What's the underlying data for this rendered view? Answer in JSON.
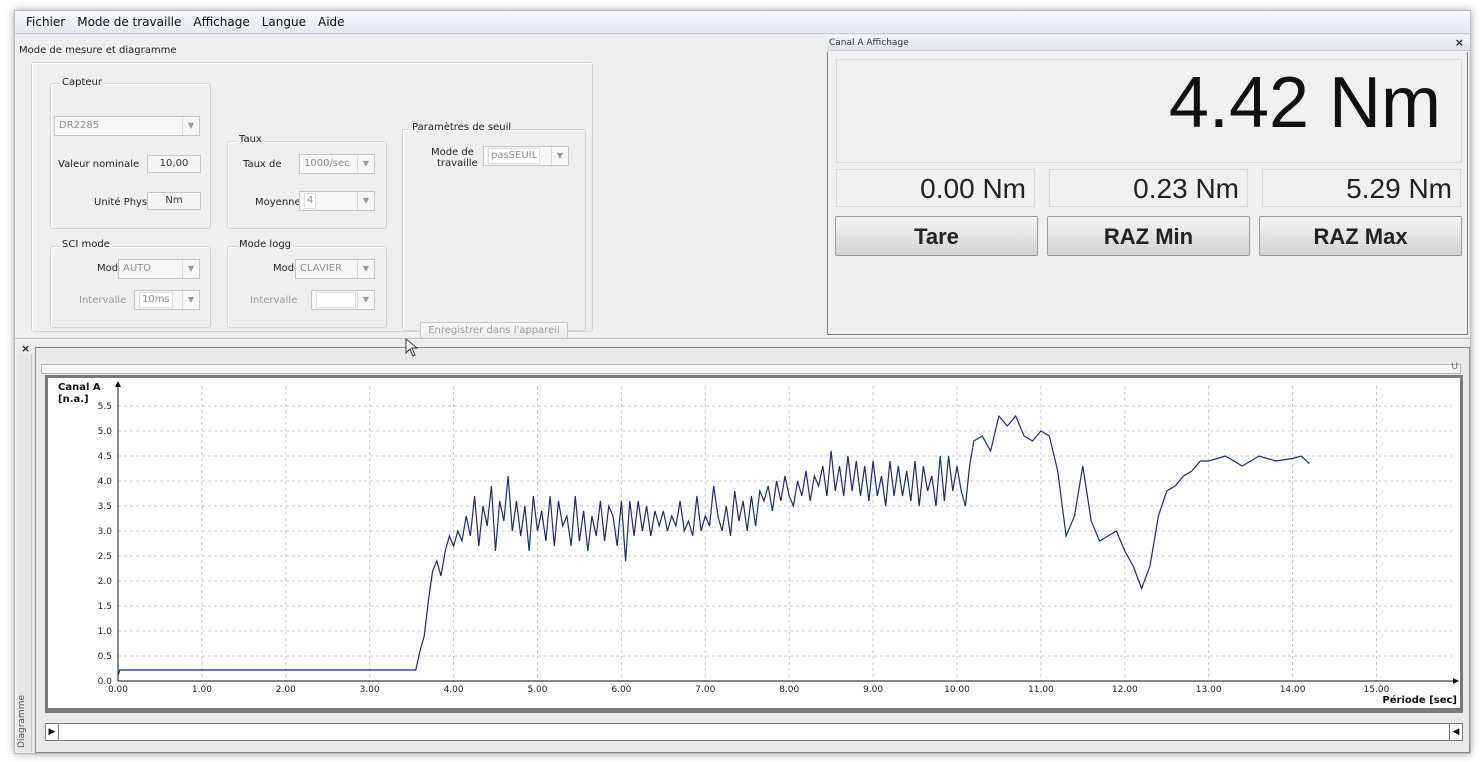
{
  "menu": [
    "Fichier",
    "Mode de travaille",
    "Affichage",
    "Langue",
    "Aide"
  ],
  "left_panel": {
    "title": "Mode de mesure et diagramme",
    "capteur": {
      "group": "Capteur",
      "sensor": "DR2285",
      "nominal_label": "Valeur nominale",
      "nominal_value": "10,00",
      "unit_label": "Unité Phys",
      "unit_value": "Nm"
    },
    "taux": {
      "group": "Taux",
      "rate_label": "Taux de",
      "rate_value": "1000/sec",
      "avg_label": "Moyenne",
      "avg_value": "4"
    },
    "seuil": {
      "group": "Paramètres de seuil",
      "mode_label_1": "Mode de",
      "mode_label_2": "travaille",
      "mode_value": "pasSEUIL"
    },
    "sci": {
      "group": "SCI mode",
      "mode_label": "Mode",
      "mode_value": "AUTO",
      "interval_label": "Intervalle",
      "interval_value": "10ms"
    },
    "logg": {
      "group": "Mode logg",
      "mode_label": "Mode",
      "mode_value": "CLAVIER",
      "interval_label": "Intervalle",
      "interval_value": ""
    },
    "save_button": "Enregistrer dans l'appareil"
  },
  "right_panel": {
    "title": "Canal A Affichage",
    "close": "×",
    "main_value": "4.42 Nm",
    "small_values": [
      "0.00 Nm",
      "0.23 Nm",
      "5.29 Nm"
    ],
    "buttons": [
      "Tare",
      "RAZ Min",
      "RAZ Max"
    ]
  },
  "diagram": {
    "close": "×",
    "side_label": "Diagramme",
    "top_slider_end": "U"
  },
  "chart_data": {
    "type": "line",
    "ylabel_1": "Canal A",
    "ylabel_2": "[n.a.]",
    "xlabel": "Période [sec]",
    "xlim": [
      0,
      15.9
    ],
    "ylim": [
      0,
      5.9
    ],
    "x_ticks": [
      "0.00",
      "1.00",
      "2.00",
      "3.00",
      "4.00",
      "5.00",
      "6.00",
      "7.00",
      "8.00",
      "9.00",
      "10.00",
      "11.00",
      "12.00",
      "13.00",
      "14.00",
      "15.00"
    ],
    "y_ticks": [
      "0.0",
      "0.5",
      "1.0",
      "1.5",
      "2.0",
      "2.5",
      "3.0",
      "3.5",
      "4.0",
      "4.5",
      "5.0",
      "5.5"
    ],
    "grid": true,
    "series_color": "#1f2a7a",
    "x": [
      0,
      0.02,
      3.55,
      3.6,
      3.65,
      3.7,
      3.75,
      3.8,
      3.85,
      3.9,
      3.95,
      4.0,
      4.05,
      4.1,
      4.15,
      4.2,
      4.25,
      4.3,
      4.35,
      4.4,
      4.45,
      4.5,
      4.55,
      4.6,
      4.65,
      4.7,
      4.75,
      4.8,
      4.85,
      4.9,
      4.95,
      5.0,
      5.05,
      5.1,
      5.15,
      5.2,
      5.25,
      5.3,
      5.35,
      5.4,
      5.45,
      5.5,
      5.55,
      5.6,
      5.65,
      5.7,
      5.75,
      5.8,
      5.85,
      5.9,
      5.95,
      6.0,
      6.05,
      6.1,
      6.15,
      6.2,
      6.25,
      6.3,
      6.35,
      6.4,
      6.45,
      6.5,
      6.55,
      6.6,
      6.65,
      6.7,
      6.75,
      6.8,
      6.85,
      6.9,
      6.95,
      7.0,
      7.05,
      7.1,
      7.15,
      7.2,
      7.25,
      7.3,
      7.35,
      7.4,
      7.45,
      7.5,
      7.55,
      7.6,
      7.65,
      7.7,
      7.75,
      7.8,
      7.85,
      7.9,
      7.95,
      8.0,
      8.05,
      8.1,
      8.15,
      8.2,
      8.25,
      8.3,
      8.35,
      8.4,
      8.45,
      8.5,
      8.55,
      8.6,
      8.65,
      8.7,
      8.75,
      8.8,
      8.85,
      8.9,
      8.95,
      9.0,
      9.05,
      9.1,
      9.15,
      9.2,
      9.25,
      9.3,
      9.35,
      9.4,
      9.45,
      9.5,
      9.55,
      9.6,
      9.65,
      9.7,
      9.75,
      9.8,
      9.85,
      9.9,
      9.95,
      10.0,
      10.05,
      10.1,
      10.15,
      10.2,
      10.3,
      10.4,
      10.5,
      10.6,
      10.7,
      10.8,
      10.9,
      11.0,
      11.1,
      11.2,
      11.3,
      11.4,
      11.5,
      11.6,
      11.7,
      11.8,
      11.9,
      12.0,
      12.1,
      12.2,
      12.3,
      12.4,
      12.5,
      12.6,
      12.7,
      12.8,
      12.9,
      13.0,
      13.2,
      13.4,
      13.6,
      13.8,
      14.0,
      14.1,
      14.2,
      14.3,
      14.4,
      14.5,
      14.6,
      14.7
    ],
    "y": [
      0.1,
      0.22,
      0.22,
      0.6,
      0.9,
      1.6,
      2.2,
      2.4,
      2.1,
      2.6,
      2.9,
      2.7,
      3.0,
      2.8,
      3.3,
      2.9,
      3.7,
      2.7,
      3.5,
      3.1,
      3.9,
      2.6,
      3.6,
      3.2,
      4.1,
      3.0,
      3.6,
      2.9,
      3.5,
      2.6,
      3.7,
      3.0,
      3.4,
      2.8,
      3.7,
      2.7,
      3.6,
      3.1,
      3.3,
      2.7,
      3.7,
      2.8,
      3.4,
      2.6,
      3.3,
      2.9,
      3.6,
      2.8,
      3.5,
      3.3,
      2.7,
      3.6,
      2.4,
      3.6,
      2.9,
      3.6,
      3.0,
      3.5,
      2.9,
      3.4,
      3.1,
      3.4,
      3.0,
      3.3,
      3.1,
      3.6,
      3.0,
      3.2,
      2.9,
      3.7,
      3.0,
      3.3,
      3.1,
      3.9,
      3.3,
      3.0,
      3.5,
      2.9,
      3.8,
      3.2,
      3.6,
      3.0,
      3.7,
      3.1,
      3.8,
      3.6,
      3.9,
      3.4,
      4.0,
      3.6,
      4.1,
      3.7,
      3.5,
      4.0,
      3.7,
      4.2,
      3.6,
      4.1,
      3.9,
      4.3,
      3.7,
      4.6,
      3.8,
      4.3,
      3.7,
      4.5,
      3.8,
      4.4,
      3.7,
      4.3,
      3.6,
      4.4,
      3.7,
      4.1,
      3.5,
      4.4,
      3.7,
      4.3,
      3.7,
      4.2,
      3.6,
      4.4,
      3.5,
      4.3,
      3.8,
      4.1,
      3.5,
      4.5,
      3.6,
      4.5,
      3.8,
      4.3,
      3.8,
      3.5,
      4.3,
      4.8,
      4.9,
      4.6,
      5.3,
      5.1,
      5.3,
      4.9,
      4.8,
      5.0,
      4.9,
      4.2,
      2.9,
      3.3,
      4.3,
      3.2,
      2.8,
      2.9,
      3.0,
      2.6,
      2.3,
      1.85,
      2.3,
      3.3,
      3.8,
      3.9,
      4.1,
      4.2,
      4.4,
      4.4,
      4.5,
      4.3,
      4.5,
      4.4,
      4.45,
      4.5,
      4.35
    ]
  }
}
